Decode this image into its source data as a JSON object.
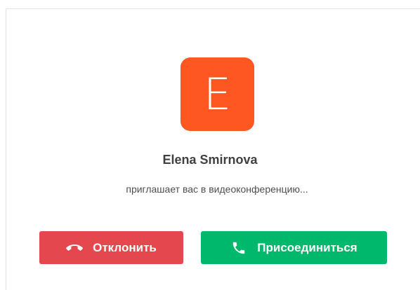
{
  "caller": {
    "avatar_letter": "E",
    "avatar_color": "#FF5722",
    "name": "Elena Smirnova",
    "message": "приглашает вас в видеоконференцию..."
  },
  "actions": {
    "decline_label": "Отклонить",
    "decline_icon": "hang-up-icon",
    "decline_color": "#E5474F",
    "accept_label": "Присоединиться",
    "accept_icon": "phone-icon",
    "accept_color": "#00B86B"
  }
}
